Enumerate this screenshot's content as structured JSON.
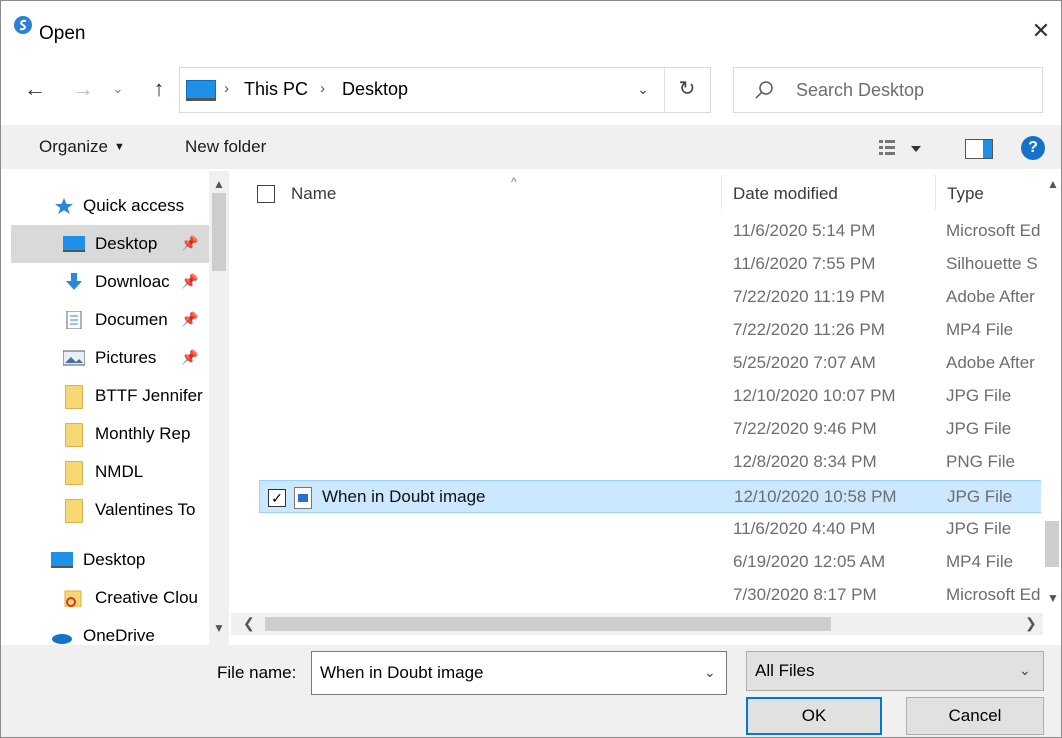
{
  "window": {
    "title": "Open",
    "close_glyph": "✕"
  },
  "nav": {
    "back": "←",
    "forward": "→",
    "recent": "⌄",
    "up": "↑"
  },
  "address": {
    "crumbs": [
      "This PC",
      "Desktop"
    ],
    "separator": "›",
    "dropdown": "⌄",
    "refresh": "↻"
  },
  "search": {
    "placeholder": "Search Desktop"
  },
  "toolbar": {
    "organize_label": "Organize",
    "new_folder_label": "New folder",
    "help": "?"
  },
  "sidebar": {
    "items": [
      {
        "label": "Quick access",
        "icon": "star-icon"
      },
      {
        "label": "Desktop",
        "icon": "desktop-icon",
        "pinned": true,
        "selected": true
      },
      {
        "label": "Downloac",
        "icon": "downloads-icon",
        "pinned": true
      },
      {
        "label": "Documen",
        "icon": "documents-icon",
        "pinned": true
      },
      {
        "label": "Pictures",
        "icon": "pictures-icon",
        "pinned": true
      },
      {
        "label": "BTTF Jennifer",
        "icon": "folder-icon"
      },
      {
        "label": "Monthly Rep",
        "icon": "folder-icon"
      },
      {
        "label": "NMDL",
        "icon": "folder-icon"
      },
      {
        "label": "Valentines To",
        "icon": "folder-icon"
      },
      {
        "label": "Desktop",
        "icon": "desktop-icon"
      },
      {
        "label": "Creative Clou",
        "icon": "creative-cloud-icon"
      },
      {
        "label": "OneDrive",
        "icon": "onedrive-icon"
      }
    ]
  },
  "filelist": {
    "columns": {
      "name": "Name",
      "date": "Date modified",
      "type": "Type"
    },
    "rows": [
      {
        "name": "",
        "date": "11/6/2020 5:14 PM",
        "type": "Microsoft Ed"
      },
      {
        "name": "",
        "date": "11/6/2020 7:55 PM",
        "type": "Silhouette S"
      },
      {
        "name": "",
        "date": "7/22/2020 11:19 PM",
        "type": "Adobe After"
      },
      {
        "name": "",
        "date": "7/22/2020 11:26 PM",
        "type": "MP4 File"
      },
      {
        "name": "",
        "date": "5/25/2020 7:07 AM",
        "type": "Adobe After"
      },
      {
        "name": "",
        "date": "12/10/2020 10:07 PM",
        "type": "JPG File"
      },
      {
        "name": "",
        "date": "7/22/2020 9:46 PM",
        "type": "JPG File"
      },
      {
        "name": "",
        "date": "12/8/2020 8:34 PM",
        "type": "PNG File"
      },
      {
        "name": "When in Doubt image",
        "date": "12/10/2020 10:58 PM",
        "type": "JPG File",
        "selected": true,
        "checked": true
      },
      {
        "name": "",
        "date": "11/6/2020 4:40 PM",
        "type": "JPG File"
      },
      {
        "name": "",
        "date": "6/19/2020 12:05 AM",
        "type": "MP4 File"
      },
      {
        "name": "",
        "date": "7/30/2020 8:17 PM",
        "type": "Microsoft Ed"
      }
    ]
  },
  "footer": {
    "file_name_label": "File name:",
    "file_name_value": "When in Doubt image",
    "file_type_value": "All Files",
    "ok_label": "OK",
    "cancel_label": "Cancel"
  },
  "colors": {
    "accent": "#0078d7",
    "selection": "#cce8ff",
    "toolbar_bg": "#f0f0f0",
    "folder": "#f7d774"
  }
}
